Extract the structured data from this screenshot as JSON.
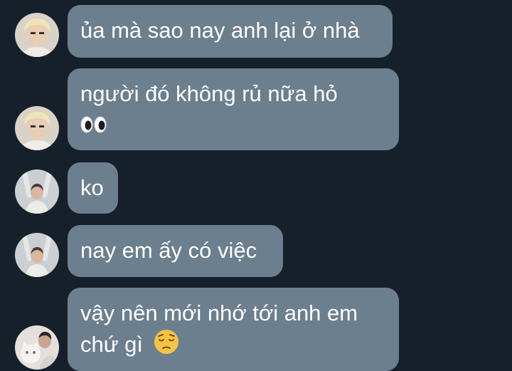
{
  "messages": [
    {
      "sender": "blonde-user",
      "lines": [
        "ủa mà sao nay anh lại ở nhà"
      ],
      "emoji": ""
    },
    {
      "sender": "blonde-user",
      "lines": [
        "người đó không rủ nữa hỏ"
      ],
      "emoji": "eyes"
    },
    {
      "sender": "arms-up-user",
      "lines": [
        "ko"
      ],
      "emoji": ""
    },
    {
      "sender": "arms-up-user",
      "lines": [
        "nay em ấy có việc"
      ],
      "emoji": ""
    },
    {
      "sender": "cat-user",
      "lines": [
        "vậy nên mới nhớ tới anh em",
        "chứ gì"
      ],
      "emoji": "pensive-face"
    }
  ],
  "colors": {
    "background": "#16202a",
    "bubble": "#6c7f8e",
    "text": "#ffffff"
  }
}
